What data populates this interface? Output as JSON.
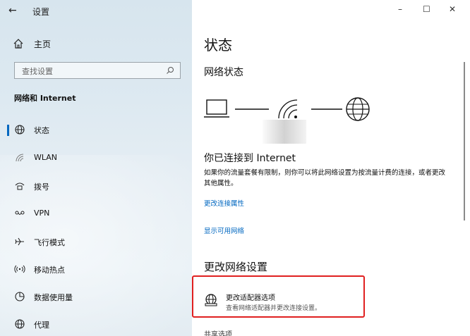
{
  "window": {
    "title": "设置",
    "back_icon": "back-arrow-icon",
    "minimize": "–",
    "maximize": "☐",
    "close": "✕"
  },
  "sidebar": {
    "home_label": "主页",
    "search_placeholder": "查找设置",
    "section_title": "网络和 Internet",
    "items": [
      {
        "label": "状态",
        "icon": "globe-icon",
        "active": true
      },
      {
        "label": "WLAN",
        "icon": "wifi-icon",
        "active": false
      },
      {
        "label": "拨号",
        "icon": "dialup-icon",
        "active": false
      },
      {
        "label": "VPN",
        "icon": "vpn-icon",
        "active": false
      },
      {
        "label": "飞行模式",
        "icon": "airplane-icon",
        "active": false
      },
      {
        "label": "移动热点",
        "icon": "hotspot-icon",
        "active": false
      },
      {
        "label": "数据使用量",
        "icon": "data-usage-icon",
        "active": false
      },
      {
        "label": "代理",
        "icon": "proxy-globe-icon",
        "active": false
      }
    ]
  },
  "main": {
    "title": "状态",
    "network_status_heading": "网络状态",
    "connected_heading": "你已连接到 Internet",
    "connected_desc": "如果你的流量套餐有限制，则你可以将此网络设置为按流量计费的连接，或者更改其他属性。",
    "link_change_props": "更改连接属性",
    "link_show_networks": "显示可用网络",
    "change_settings_heading": "更改网络设置",
    "adapter_option": {
      "title": "更改适配器选项",
      "subtitle": "查看网络适配器并更改连接设置。"
    },
    "cutoff_text": "共享选项"
  },
  "colors": {
    "accent": "#0067c0",
    "highlight": "#e02020"
  }
}
